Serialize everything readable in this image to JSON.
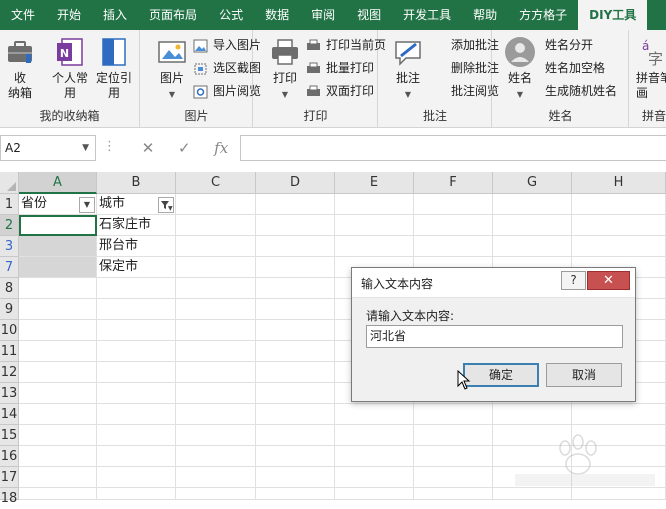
{
  "tabs": [
    "文件",
    "开始",
    "插入",
    "页面布局",
    "公式",
    "数据",
    "审阅",
    "视图",
    "开发工具",
    "帮助",
    "方方格子",
    "DIY工具"
  ],
  "active_tab": 11,
  "ribbon": {
    "groups": {
      "favorites": {
        "label": "我的收纳箱",
        "buttons": [
          {
            "label": "收\n纳箱"
          },
          {
            "label": "个人常\n用"
          },
          {
            "label": "定位引\n用"
          }
        ]
      },
      "picture": {
        "label": "图片",
        "big": "图片",
        "small": [
          "导入图片",
          "选区截图",
          "图片阅览"
        ]
      },
      "print": {
        "label": "打印",
        "big": "打印",
        "small": [
          "打印当前页",
          "批量打印",
          "双面打印"
        ]
      },
      "comment": {
        "label": "批注",
        "big": "批注",
        "small": [
          "添加批注",
          "删除批注",
          "批注阅览"
        ]
      },
      "name": {
        "label": "姓名",
        "big": "姓名",
        "small": [
          "姓名分开",
          "姓名加空格",
          "生成随机姓名"
        ]
      },
      "pinyin": {
        "label": "拼音",
        "big": "拼音笔\n画"
      }
    }
  },
  "formula_bar": {
    "name_box": "A2",
    "fx": "fx",
    "value": ""
  },
  "grid": {
    "columns": [
      "A",
      "B",
      "C",
      "D",
      "E",
      "F",
      "G",
      "H"
    ],
    "rows": [
      "1",
      "2",
      "3",
      "7",
      "8",
      "9",
      "10",
      "11",
      "12",
      "13",
      "14",
      "15",
      "16",
      "17",
      "18"
    ],
    "cells": {
      "A1": "省份",
      "B1": "城市",
      "B2": "石家庄市",
      "B3": "邢台市",
      "B7": "保定市"
    }
  },
  "dialog": {
    "title": "输入文本内容",
    "help": "?",
    "close": "✕",
    "label": "请输入文本内容:",
    "input_value": "河北省",
    "ok": "确定",
    "cancel": "取消"
  },
  "colors": {
    "accent": "#217346",
    "filtered_row": "#3a68c8",
    "dialog_close": "#c75050"
  }
}
